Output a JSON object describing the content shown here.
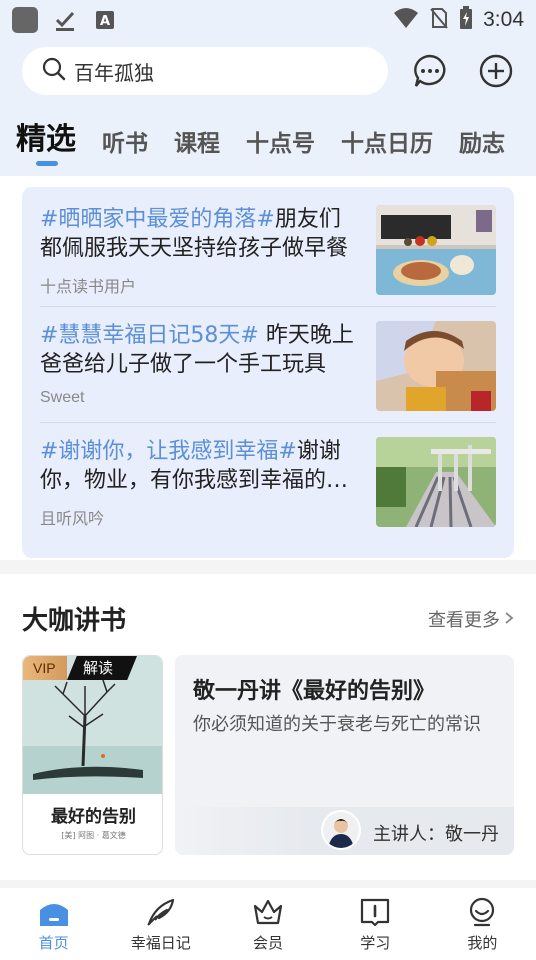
{
  "status_bar": {
    "time": "3:04"
  },
  "search": {
    "query": "百年孤独"
  },
  "tabs": [
    {
      "label": "精选"
    },
    {
      "label": "听书"
    },
    {
      "label": "课程"
    },
    {
      "label": "十点号"
    },
    {
      "label": "十点日历"
    },
    {
      "label": "励志"
    }
  ],
  "feed": [
    {
      "hashtag": "#晒晒家中最爱的角落#",
      "text": "朋友们都佩服我天天坚持给孩子做早餐",
      "author": "十点读书用户"
    },
    {
      "hashtag": "#慧慧幸福日记58天#",
      "text": " 昨天晚上爸爸给儿子做了一个手工玩具",
      "author": "Sweet"
    },
    {
      "hashtag": "#谢谢你，让我感到幸福#",
      "text": "谢谢你，物业，有你我感到幸福的每一天",
      "author": "且听风吟"
    }
  ],
  "section": {
    "title": "大咖讲书",
    "more": "查看更多"
  },
  "book": {
    "vip": "VIP",
    "badge": "解读",
    "title": "最好的告别",
    "credits": "[美] 阿图 · 葛文德"
  },
  "talk": {
    "title": "敬一丹讲《最好的告别》",
    "desc": "你必须知道的关于衰老与死亡的常识",
    "speaker": "主讲人：敬一丹"
  },
  "nav": [
    {
      "label": "首页",
      "icon": "home-icon"
    },
    {
      "label": "幸福日记",
      "icon": "feather-icon"
    },
    {
      "label": "会员",
      "icon": "crown-icon"
    },
    {
      "label": "学习",
      "icon": "book-icon"
    },
    {
      "label": "我的",
      "icon": "profile-icon"
    }
  ],
  "colors": {
    "accent": "#4a90e2",
    "hashtag": "#5b8fd9",
    "header_bg": "#eaf1fb",
    "feed_bg": "#e8eefb"
  }
}
